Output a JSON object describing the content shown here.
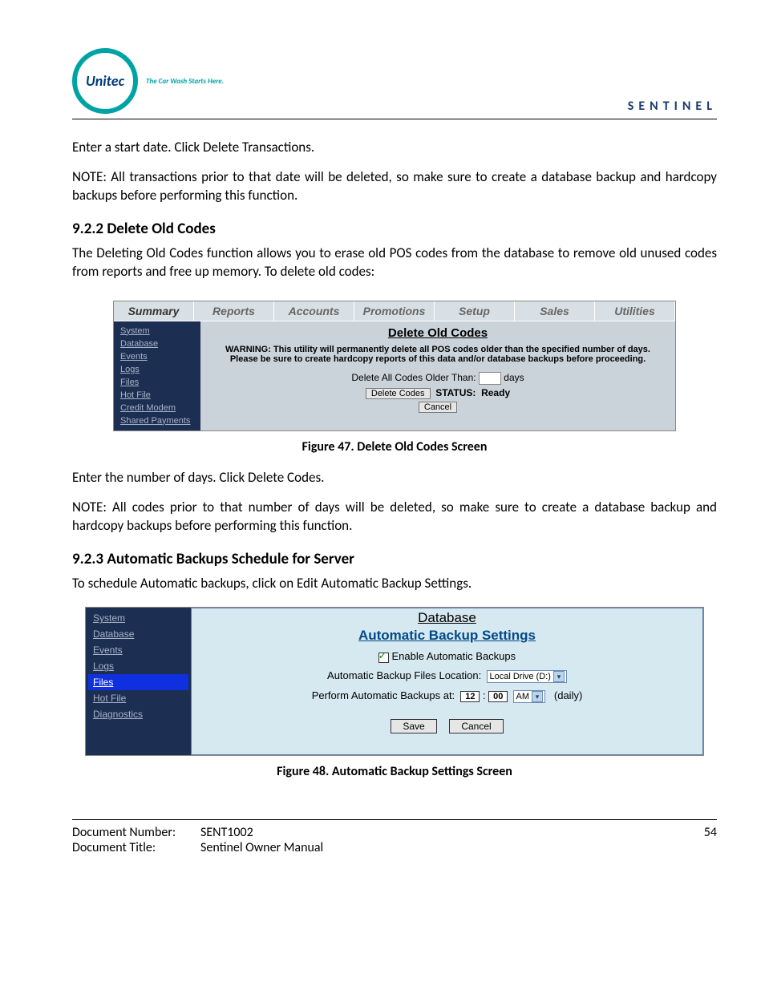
{
  "header": {
    "logo_text": "Unitec",
    "tagline": "The Car Wash Starts Here.",
    "product": "SENTINEL"
  },
  "intro": {
    "p1": "Enter a start date. Click Delete Transactions.",
    "note": "NOTE:  All transactions prior to that date will be deleted, so make sure to create a database backup and hardcopy backups before performing this function."
  },
  "sec922": {
    "heading": "9.2.2  Delete Old Codes",
    "desc": "The Deleting Old Codes function allows you to erase old POS codes from the database to remove old unused codes from reports and free up memory. To delete old codes:",
    "figure_caption": "Figure 47. Delete Old Codes Screen",
    "after1": "Enter the number of days. Click Delete Codes.",
    "after_note": "NOTE:  All codes prior to that number of days will be deleted, so make sure to create a database backup and hardcopy backups before performing this function."
  },
  "ss1": {
    "tabs": [
      "Summary",
      "Reports",
      "Accounts",
      "Promotions",
      "Setup",
      "Sales",
      "Utilities"
    ],
    "side": [
      "System",
      "Database",
      "Events",
      "Logs",
      "Files",
      "Hot File",
      "Credit Modem",
      "Shared Payments"
    ],
    "title": "Delete Old Codes",
    "warn": "WARNING: This utility will permanently delete all POS codes older than the specified number of days. Please be sure to create hardcopy reports of this data and/or database backups before proceeding.",
    "label_older": "Delete All Codes Older Than:",
    "label_days": "days",
    "btn_delete": "Delete Codes",
    "status_label": "STATUS:",
    "status_value": "Ready",
    "btn_cancel": "Cancel"
  },
  "sec923": {
    "heading": "9.2.3  Automatic Backups Schedule for Server",
    "desc": "To schedule Automatic backups, click on Edit Automatic Backup Settings.",
    "figure_caption": "Figure 48. Automatic Backup Settings Screen"
  },
  "ss2": {
    "side": [
      "System",
      "Database",
      "Events",
      "Logs",
      "Files",
      "Hot File",
      "Diagnostics"
    ],
    "side_selected": "Files",
    "h1": "Database",
    "h2": "Automatic Backup Settings",
    "enable_label": "Enable Automatic Backups",
    "loc_label": "Automatic Backup Files Location:",
    "loc_value": "Local Drive (D:)",
    "time_label": "Perform Automatic Backups at:",
    "time_hh": "12",
    "time_mm": "00",
    "ampm": "AM",
    "daily": "(daily)",
    "btn_save": "Save",
    "btn_cancel": "Cancel"
  },
  "footer": {
    "docnum_label": "Document Number:",
    "docnum": "SENT1002",
    "title_label": "Document Title:",
    "title": "Sentinel Owner Manual",
    "page": "54"
  }
}
